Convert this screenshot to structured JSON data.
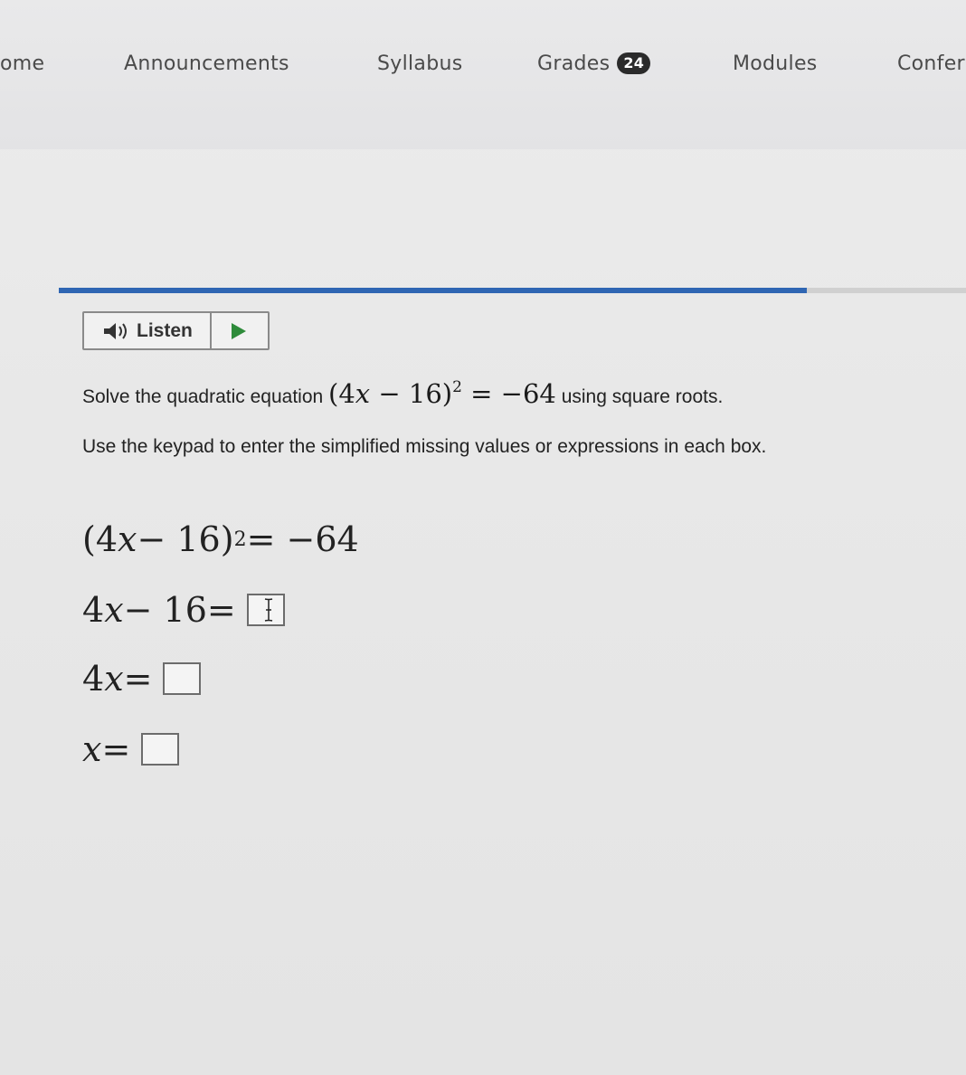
{
  "nav": {
    "items": [
      {
        "label": "ome"
      },
      {
        "label": "Announcements"
      },
      {
        "label": "Syllabus"
      },
      {
        "label": "Grades",
        "badge": "24"
      },
      {
        "label": "Modules"
      },
      {
        "label": "Confer"
      }
    ]
  },
  "progress": {
    "fraction": 0.825,
    "fill_color": "#2f66b3"
  },
  "listen": {
    "label": "Listen",
    "speaker_icon": "speaker-icon",
    "play_icon": "play-icon"
  },
  "question": {
    "prefix": "Solve the quadratic equation ",
    "equation_base": "(4",
    "equation_var": "x",
    "equation_mid": " − 16)",
    "equation_exp": "2",
    "equation_rhs": " = −64",
    "suffix": " using square roots."
  },
  "instructions": "Use the keypad to enter the simplified missing values or expressions in each box.",
  "steps": [
    {
      "lhs_a": "(4",
      "lhs_var": "x",
      "lhs_b": " − 16)",
      "exp": "2",
      "rhs": " = −64"
    },
    {
      "lhs_a": "4",
      "lhs_var": "x",
      "lhs_b": " − 16 ",
      "rhs": "="
    },
    {
      "lhs_a": "4",
      "lhs_var": "x",
      "lhs_b": " ",
      "rhs": "="
    },
    {
      "lhs_a": "",
      "lhs_var": "x",
      "lhs_b": " ",
      "rhs": "="
    }
  ]
}
